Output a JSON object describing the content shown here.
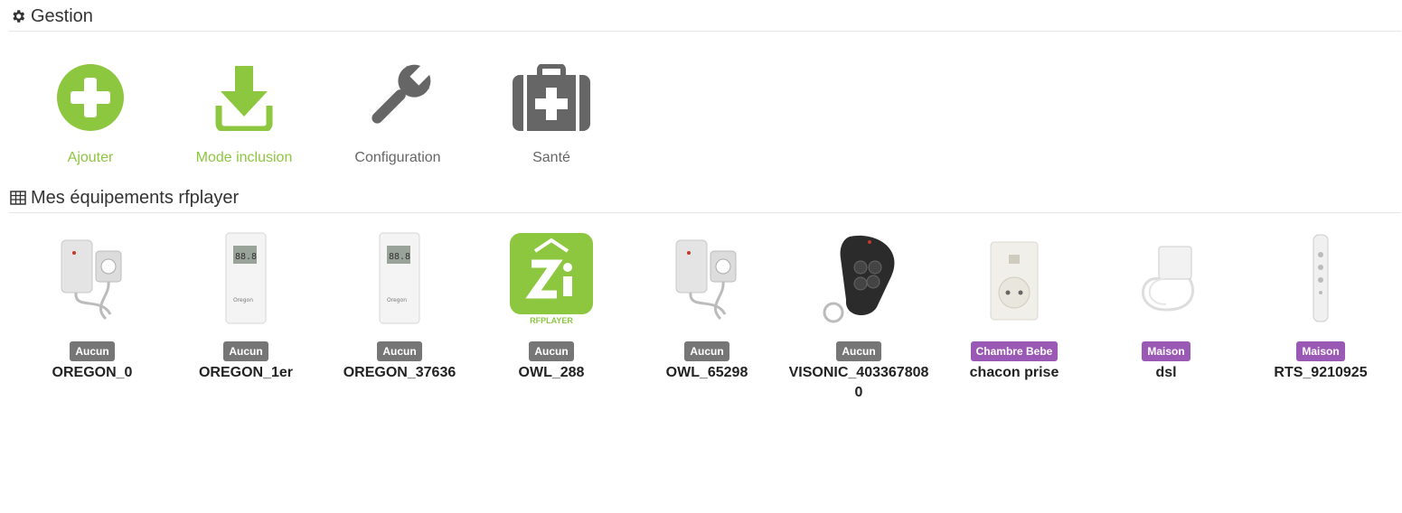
{
  "gestion": {
    "title": "Gestion",
    "actions": [
      {
        "label": "Ajouter",
        "icon": "plus-circle-icon",
        "color": "#8dc63f"
      },
      {
        "label": "Mode inclusion",
        "icon": "download-icon",
        "color": "#8dc63f"
      },
      {
        "label": "Configuration",
        "icon": "wrench-icon",
        "color": "#666666"
      },
      {
        "label": "Santé",
        "icon": "medkit-icon",
        "color": "#666666"
      }
    ]
  },
  "equipements": {
    "title": "Mes équipements rfplayer",
    "items": [
      {
        "object": "Aucun",
        "object_color": "#767676",
        "name": "OREGON_0",
        "image": "current-clamp-sensor"
      },
      {
        "object": "Aucun",
        "object_color": "#767676",
        "name": "OREGON_1er",
        "image": "oregon-thermo-sensor"
      },
      {
        "object": "Aucun",
        "object_color": "#767676",
        "name": "OREGON_37636",
        "image": "oregon-thermo-sensor"
      },
      {
        "object": "Aucun",
        "object_color": "#767676",
        "name": "OWL_288",
        "image": "rfplayer-logo",
        "logo_text": "RFPLAYER"
      },
      {
        "object": "Aucun",
        "object_color": "#767676",
        "name": "OWL_65298",
        "image": "current-clamp-sensor"
      },
      {
        "object": "Aucun",
        "object_color": "#767676",
        "name": "VISONIC_4033678080",
        "image": "keyfob-remote"
      },
      {
        "object": "Chambre Bebe",
        "object_color": "#9b59b6",
        "name": "chacon prise",
        "image": "smart-plug"
      },
      {
        "object": "Maison",
        "object_color": "#9b59b6",
        "name": "dsl",
        "image": "micro-module"
      },
      {
        "object": "Maison",
        "object_color": "#9b59b6",
        "name": "RTS_9210925",
        "image": "rts-remote"
      }
    ]
  }
}
